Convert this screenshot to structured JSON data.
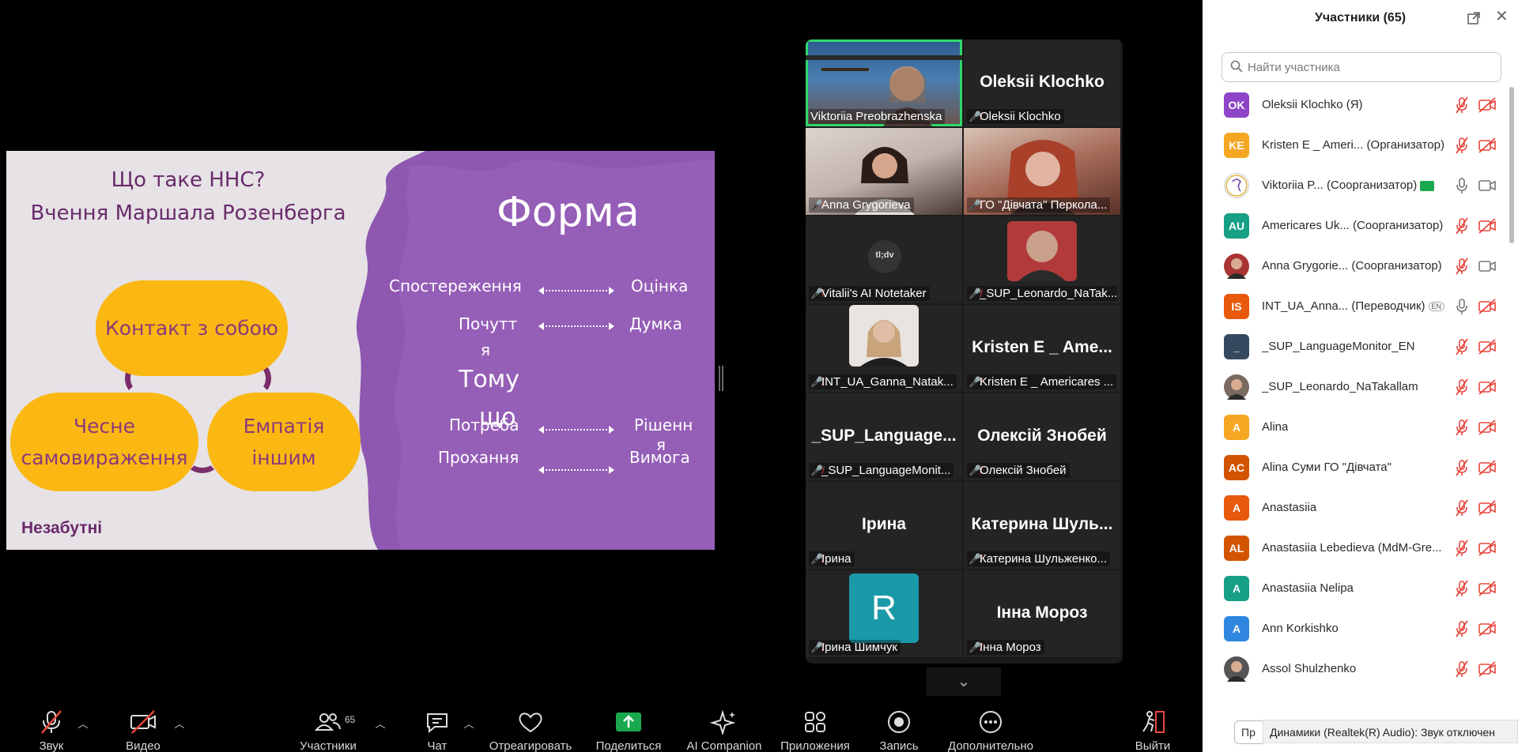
{
  "slide": {
    "title_line1": "Що таке ННС?",
    "title_line2": "Вчення Маршала Розенберга",
    "pill_contact": "Контакт з собою",
    "pill_honest_line1": "Чесне",
    "pill_honest_line2": "самовираження",
    "pill_empathy_line1": "Емпатія",
    "pill_empathy_line2": "іншим",
    "brand": "Незабутні",
    "heading": "Форма",
    "left_words": [
      "Спостереження",
      "Почутт",
      "я",
      "Потреба",
      "Прохання"
    ],
    "overlay_word_1": "Тому",
    "overlay_word_2": "що",
    "right_words": [
      "Оцінка",
      "Думка",
      "Рішенн",
      "я",
      "Вимога"
    ],
    "colors": {
      "background": "#e6e2e6",
      "blob": "#8e57b0",
      "pill": "#fbb812",
      "text": "#6a2b6a"
    }
  },
  "gallery": {
    "tiles": [
      {
        "display_name": "",
        "label": "Viktoriia Preobrazhenska",
        "muted": false,
        "video": "vid-a",
        "active": true
      },
      {
        "display_name": "Oleksii Klochko",
        "label": "Oleksii Klochko",
        "muted": true
      },
      {
        "display_name": "",
        "label": "Anna Grygorieva",
        "muted": true,
        "video": "vid-b"
      },
      {
        "display_name": "",
        "label": "ГО \"Дівчата\" Перкола...",
        "muted": true,
        "video": "vid-c"
      },
      {
        "display_name": "",
        "label": "Vitalii's AI Notetaker",
        "muted": true,
        "avatar_text": "tl;dv"
      },
      {
        "display_name": "",
        "label": "_SUP_Leonardo_NaTak...",
        "muted": true,
        "photo": true
      },
      {
        "display_name": "",
        "label": "INT_UA_Ganna_Natak...",
        "muted": true,
        "photo": true
      },
      {
        "display_name": "Kristen E _ Ame...",
        "label": "Kristen E _ Americares ...",
        "muted": true
      },
      {
        "display_name": "_SUP_Language...",
        "label": "_SUP_LanguageMonit...",
        "muted": true
      },
      {
        "display_name": "Олексій Знобей",
        "label": "Олексій Знобей",
        "muted": true
      },
      {
        "display_name": "Ірина",
        "label": "Ірина",
        "muted": true
      },
      {
        "display_name": "Катерина Шуль...",
        "label": "Катерина Шульженко...",
        "muted": true
      },
      {
        "display_name": "",
        "label": "Ірина Шимчук",
        "muted": true,
        "avatar_letter": "R"
      },
      {
        "display_name": "Інна Мороз",
        "label": "Інна Мороз",
        "muted": true
      }
    ]
  },
  "participants_panel": {
    "title": "Участники (65)",
    "search_placeholder": "Найти участника",
    "participants": [
      {
        "initials": "OK",
        "color": "#8e44c7",
        "name": "Oleksii Klochko (Я)",
        "mic": "muted",
        "cam": "off"
      },
      {
        "initials": "KE",
        "color": "#f5a623",
        "name": "Kristen E _ Ameri...  (Организатор)",
        "mic": "muted",
        "cam": "off"
      },
      {
        "initials": "",
        "color": "#ffffff",
        "name": "Viktoriia P...  (Соорганизатор)",
        "mic": "on",
        "cam": "on",
        "sharing": true,
        "photo": "logo"
      },
      {
        "initials": "AU",
        "color": "#16a085",
        "name": "Americares Uk...  (Соорганизатор)",
        "mic": "muted",
        "cam": "off"
      },
      {
        "initials": "",
        "color": "#a33",
        "name": "Anna Grygorie...  (Соорганизатор)",
        "mic": "muted",
        "cam": "on",
        "photo": "face"
      },
      {
        "initials": "IS",
        "color": "#e8590c",
        "name": "INT_UA_Anna...  (Переводчик)",
        "mic": "on",
        "cam": "off",
        "lang": "EN"
      },
      {
        "initials": "_",
        "color": "#34495e",
        "name": "_SUP_LanguageMonitor_EN",
        "mic": "muted",
        "cam": "off"
      },
      {
        "initials": "",
        "color": "#7a6a60",
        "name": "_SUP_Leonardo_NaTakallam",
        "mic": "muted",
        "cam": "off",
        "photo": "face"
      },
      {
        "initials": "A",
        "color": "#f5a623",
        "name": "Alina",
        "mic": "muted",
        "cam": "off"
      },
      {
        "initials": "AC",
        "color": "#d35400",
        "name": "Alina Суми ГО \"Дівчата\"",
        "mic": "muted",
        "cam": "off"
      },
      {
        "initials": "A",
        "color": "#e8590c",
        "name": "Anastasiia",
        "mic": "muted",
        "cam": "off"
      },
      {
        "initials": "AL",
        "color": "#d35400",
        "name": "Anastasiia Lebedieva (MdM-Gre...",
        "mic": "muted",
        "cam": "off"
      },
      {
        "initials": "A",
        "color": "#16a085",
        "name": "Anastasiia Nelipa",
        "mic": "muted",
        "cam": "off"
      },
      {
        "initials": "A",
        "color": "#2e86de",
        "name": "Ann Korkishko",
        "mic": "muted",
        "cam": "off"
      },
      {
        "initials": "",
        "color": "#555",
        "name": "Assol Shulzhenko",
        "mic": "muted",
        "cam": "off",
        "photo": "face"
      }
    ],
    "bottom_button": "Пр",
    "tooltip": "Динамики (Realtek(R) Audio): Звук отключен"
  },
  "toolbar": {
    "items": [
      {
        "id": "audio",
        "label": "Звук",
        "icon": "mic-off-icon"
      },
      {
        "id": "video",
        "label": "Видео",
        "icon": "video-off-icon"
      },
      {
        "id": "participants",
        "label": "Участники",
        "icon": "participants-icon",
        "count": "65"
      },
      {
        "id": "chat",
        "label": "Чат",
        "icon": "chat-icon"
      },
      {
        "id": "react",
        "label": "Отреагировать",
        "icon": "heart-icon"
      },
      {
        "id": "share",
        "label": "Поделиться",
        "icon": "share-screen-icon"
      },
      {
        "id": "ai",
        "label": "AI Companion",
        "icon": "sparkle-icon"
      },
      {
        "id": "apps",
        "label": "Приложения",
        "icon": "apps-icon"
      },
      {
        "id": "record",
        "label": "Запись",
        "icon": "record-icon"
      },
      {
        "id": "more",
        "label": "Дополнительно",
        "icon": "more-icon"
      },
      {
        "id": "leave",
        "label": "Выйти",
        "icon": "leave-icon"
      }
    ],
    "colors": {
      "muted_red": "#e8463c",
      "share_green": "#1aa84f"
    }
  }
}
